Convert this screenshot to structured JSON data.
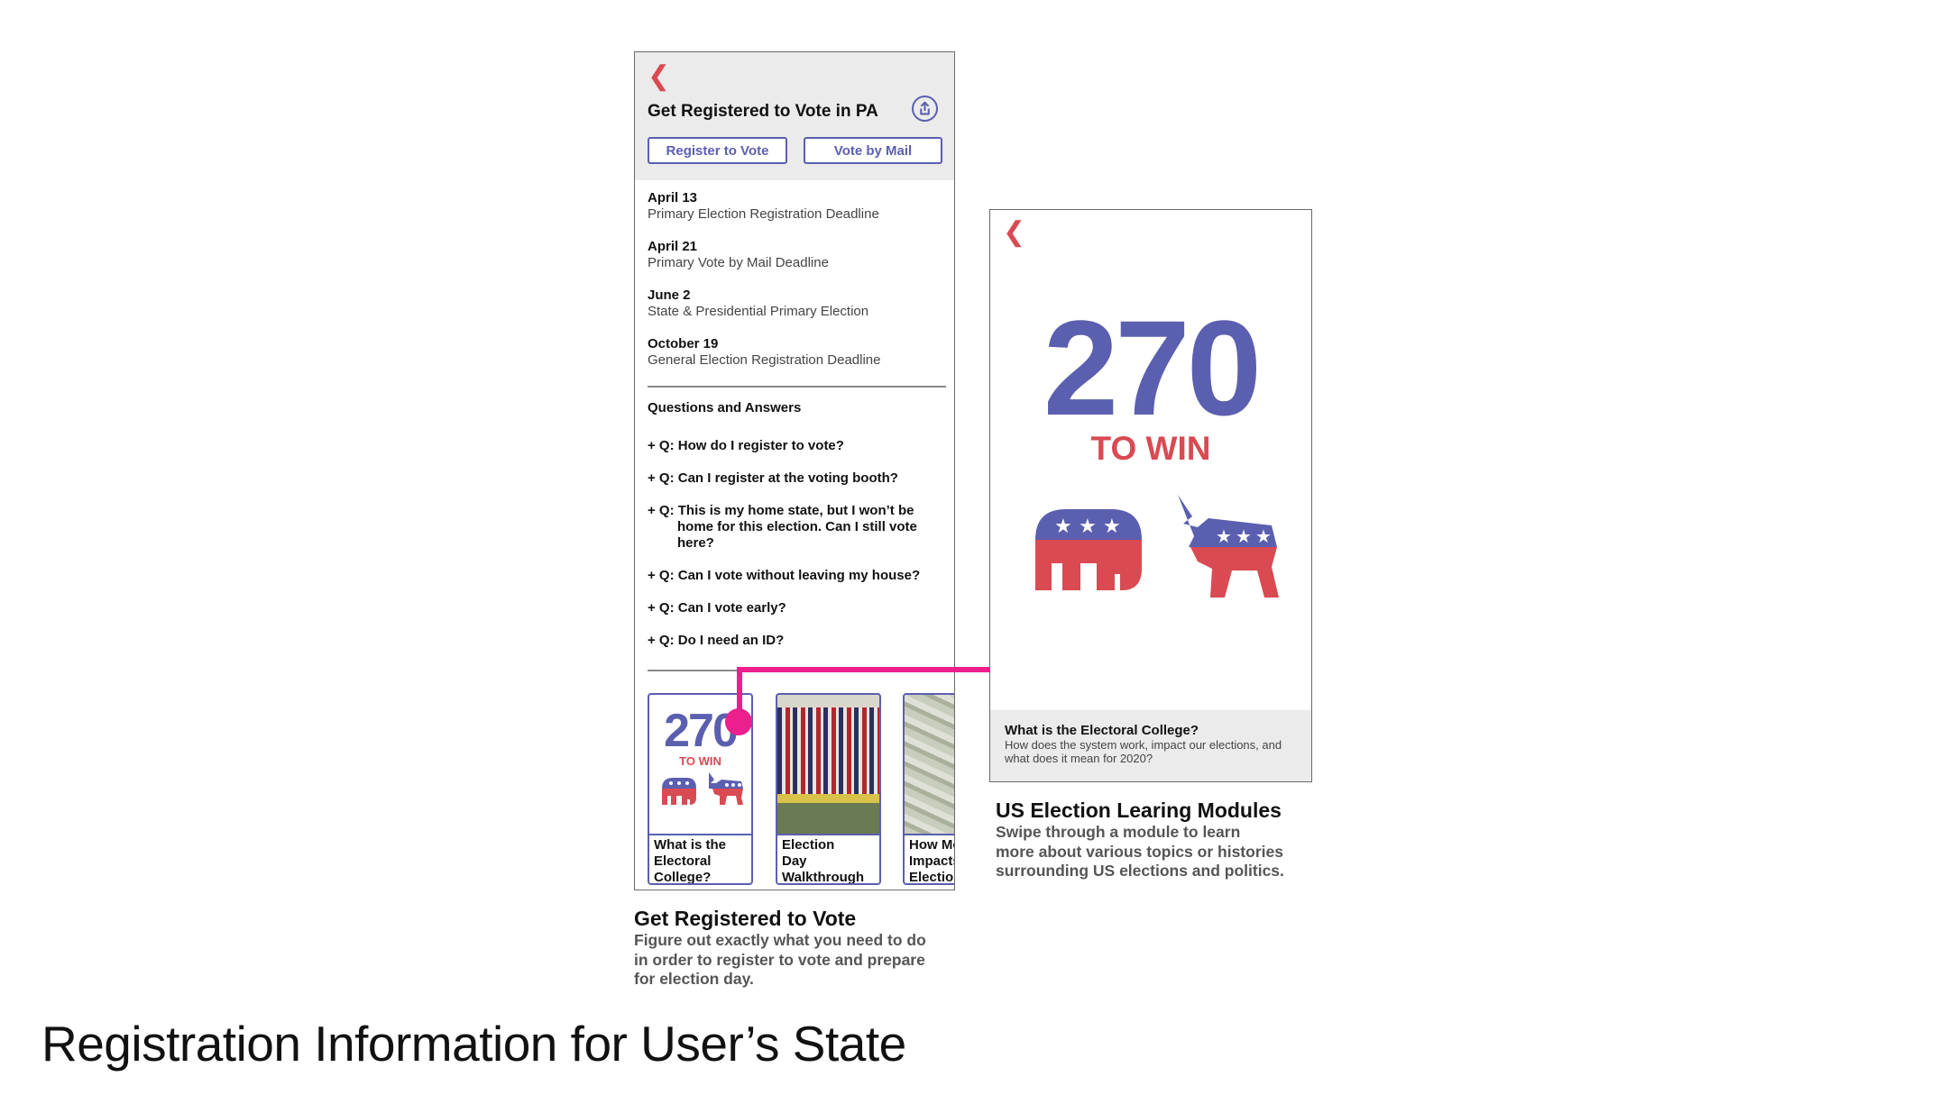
{
  "main_title": "Registration Information for User’s State",
  "colors": {
    "accent": "#5b5faf",
    "red": "#d94a52",
    "magenta": "#ec1f8c"
  },
  "phone1": {
    "back_icon": "chevron-left-icon",
    "title": "Get Registered to Vote in PA",
    "share_icon": "share-icon",
    "buttons": {
      "register": "Register to Vote",
      "mail": "Vote by Mail"
    },
    "dates": [
      {
        "date": "April 13",
        "label": "Primary Election Registration Deadline"
      },
      {
        "date": "April 21",
        "label": "Primary Vote by Mail Deadline"
      },
      {
        "date": "June 2",
        "label": "State & Presidential Primary Election"
      },
      {
        "date": "October 19",
        "label": "General Election Registration Deadline"
      }
    ],
    "qa_title": "Questions and Answers",
    "questions": [
      {
        "first": "+ Q: How do I register to vote?",
        "rest": []
      },
      {
        "first": "+ Q: Can I register at the voting booth?",
        "rest": []
      },
      {
        "first": "+ Q: This is my home state, but I won’t be",
        "rest": [
          "home for this election. Can I still vote",
          "here?"
        ]
      },
      {
        "first": "+ Q: Can I vote without leaving my house?",
        "rest": []
      },
      {
        "first": "+ Q: Can I vote early?",
        "rest": []
      },
      {
        "first": "+ Q: Do I need an ID?",
        "rest": []
      }
    ],
    "cards": [
      {
        "big": "270",
        "small": "TO WIN",
        "lines": [
          "What is the",
          "Electoral",
          "College?"
        ]
      },
      {
        "lines": [
          "Election",
          "Day",
          "Walkthrough"
        ]
      },
      {
        "lines": [
          "How Mo",
          "Impacts",
          "Election"
        ]
      }
    ]
  },
  "phone2": {
    "back_icon": "chevron-left-icon",
    "big_number": "270",
    "subtitle": "TO WIN",
    "footer_title": "What is the Electoral College?",
    "footer_desc": "How does the system work, impact our elections, and what does it mean for 2020?"
  },
  "captions": {
    "left": {
      "title": "Get Registered to Vote",
      "lines": [
        "Figure out exactly what you need to do",
        "in order to register to vote and prepare",
        "for election day."
      ]
    },
    "right": {
      "title": "US Election Learing Modules",
      "lines": [
        "Swipe through a module to learn",
        "more about various topics or histories",
        "surrounding US elections and politics."
      ]
    }
  }
}
